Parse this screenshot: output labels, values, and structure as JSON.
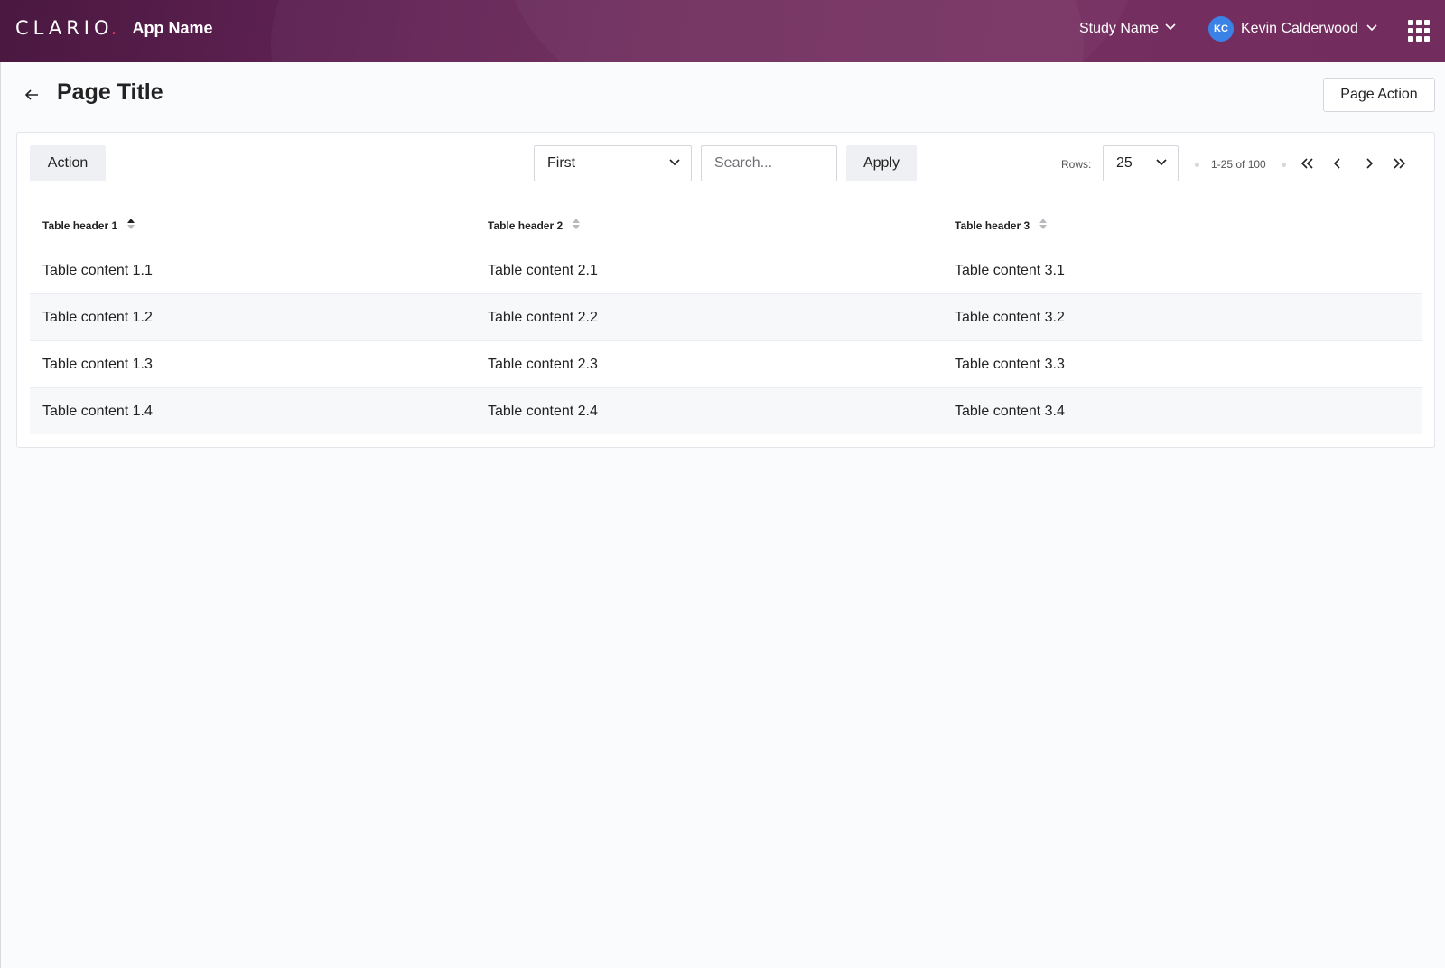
{
  "header": {
    "logo_text": "CLARIO",
    "logo_dot": ".",
    "app_name": "App Name",
    "study_name": "Study Name",
    "user": {
      "initials": "KC",
      "name": "Kevin Calderwood"
    },
    "colors": {
      "bar": "#6d2a5c",
      "avatar": "#3b82e6",
      "logo_dot": "#e0306a"
    }
  },
  "page": {
    "title": "Page Title",
    "action_label": "Page Action"
  },
  "toolbar": {
    "action_label": "Action",
    "filter_selected": "First",
    "search_placeholder": "Search...",
    "apply_label": "Apply",
    "rows_label": "Rows:",
    "rows_value": "25",
    "range_text": "1-25 of 100"
  },
  "table": {
    "headers": [
      "Table header 1",
      "Table header 2",
      "Table header 3"
    ],
    "rows": [
      [
        "Table content 1.1",
        "Table content 2.1",
        "Table content 3.1"
      ],
      [
        "Table content 1.2",
        "Table content 2.2",
        "Table content 3.2"
      ],
      [
        "Table content 1.3",
        "Table content 2.3",
        "Table content 3.3"
      ],
      [
        "Table content 1.4",
        "Table content 2.4",
        "Table content 3.4"
      ]
    ]
  }
}
